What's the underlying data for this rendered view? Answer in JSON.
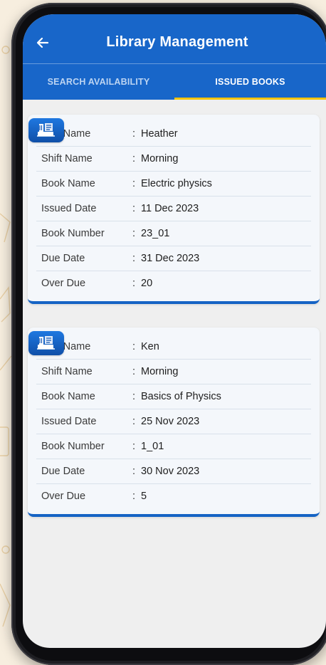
{
  "header": {
    "title": "Library Management",
    "back_icon": "arrow-left-icon"
  },
  "tabs": [
    {
      "label": "SEARCH AVAILABILITY",
      "active": false
    },
    {
      "label": "ISSUED BOOKS",
      "active": true
    }
  ],
  "labels": {
    "username": "UserName",
    "shift": "Shift Name",
    "book": "Book Name",
    "issued": "Issued Date",
    "number": "Book Number",
    "due": "Due Date",
    "overdue": "Over Due",
    "separator": ":"
  },
  "issued_books": [
    {
      "icon": "library-book-icon",
      "username": "Heather",
      "shift": "Morning",
      "book": "Electric physics",
      "issued": "11 Dec 2023",
      "number": "23_01",
      "due": "31 Dec 2023",
      "overdue": "20"
    },
    {
      "icon": "library-book-icon",
      "username": "Ken",
      "shift": "Morning",
      "book": "Basics of Physics",
      "issued": "25 Nov 2023",
      "number": "1_01",
      "due": "30 Nov 2023",
      "overdue": "5"
    }
  ],
  "colors": {
    "app_bar": "#1866c9",
    "tab_indicator": "#f5c400",
    "card_bg": "#f4f7fb",
    "card_accent": "#1563c4"
  }
}
